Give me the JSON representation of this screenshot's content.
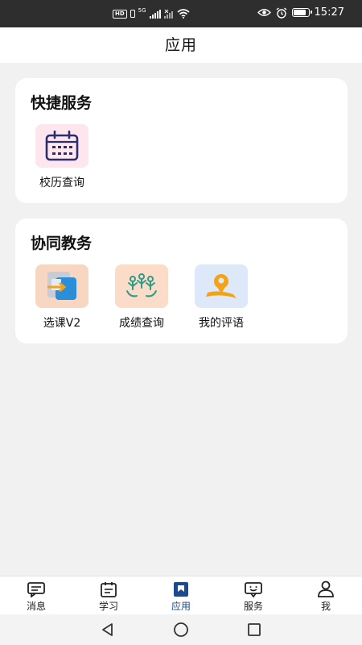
{
  "status_bar": {
    "hd": "HD",
    "network": "5G",
    "time": "15:27",
    "battery_level": 0.85
  },
  "header": {
    "title": "应用"
  },
  "sections": [
    {
      "title": "快捷服务",
      "items": [
        {
          "label": "校历查询",
          "icon": "calendar-icon",
          "bg": "#fde6ee"
        }
      ]
    },
    {
      "title": "协同教务",
      "items": [
        {
          "label": "选课V2",
          "icon": "course-select-icon",
          "bg": "#f8d7c2"
        },
        {
          "label": "成绩查询",
          "icon": "group-grades-icon",
          "bg": "#fbdcc9"
        },
        {
          "label": "我的评语",
          "icon": "location-comment-icon",
          "bg": "#dde9f8"
        }
      ]
    }
  ],
  "bottom_nav": {
    "active_index": 2,
    "active_color": "#1c4a8e",
    "items": [
      {
        "label": "消息",
        "icon": "message-icon"
      },
      {
        "label": "学习",
        "icon": "study-icon"
      },
      {
        "label": "应用",
        "icon": "apps-icon"
      },
      {
        "label": "服务",
        "icon": "service-icon"
      },
      {
        "label": "我",
        "icon": "profile-icon"
      }
    ]
  },
  "system_nav": {
    "back": "back-icon",
    "home": "home-icon",
    "recents": "recents-icon"
  }
}
